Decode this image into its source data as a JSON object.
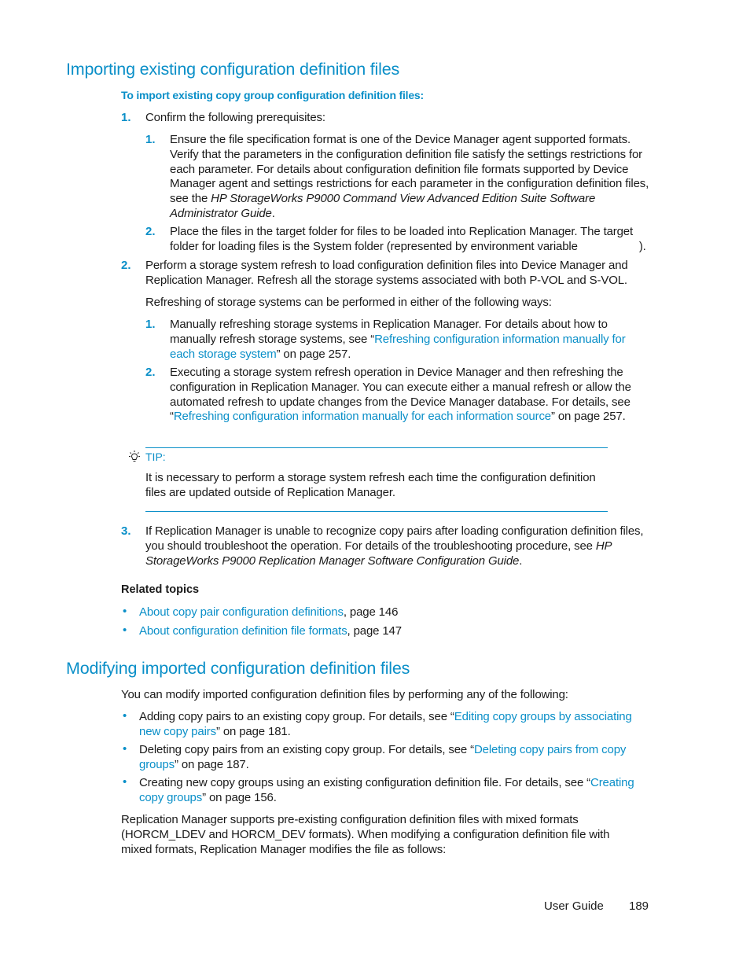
{
  "section1": {
    "heading": "Importing existing configuration definition files",
    "procedure_title": "To import existing copy group configuration definition files:",
    "steps": [
      {
        "number": "1.",
        "text": "Confirm the following prerequisites:",
        "substeps": [
          {
            "number": "1.",
            "text_a": "Ensure the file specification format is one of the Device Manager agent supported  formats. Verify that the parameters in the configuration definition file satisfy the settings restrictions for each parameter. For details about configuration definition file formats supported by Device Manager agent and settings restrictions for each parameter in the configuration definition files, see the ",
            "italic": "HP StorageWorks P9000 Command View Advanced Edition Suite Software Administrator Guide",
            "text_b": "."
          },
          {
            "number": "2.",
            "text_a": "Place the files in the target folder for files to be loaded into Replication Manager. The target folder for loading files is the System folder (represented by environment variable",
            "text_b": ")."
          }
        ]
      },
      {
        "number": "2.",
        "text": "Perform a storage system refresh to load configuration definition files into Device Manager and Replication Manager. Refresh all the storage systems associated with both P-VOL and S-VOL.",
        "para": "Refreshing of storage systems can be performed in either of the following ways:",
        "substeps": [
          {
            "number": "1.",
            "text_a": "Manually refreshing storage systems in Replication Manager. For details about how to manually refresh storage systems, see “",
            "link": "Refreshing configuration information manually for each storage system",
            "text_b": "” on page 257."
          },
          {
            "number": "2.",
            "text_a": "Executing a storage system refresh operation in Device Manager and then refreshing the configuration in Replication Manager. You can execute either a manual refresh or allow the automated refresh to update changes from the Device Manager database. For details, see “",
            "link": "Refreshing configuration information manually for each information source",
            "text_b": "” on page 257."
          }
        ]
      },
      {
        "number": "3.",
        "text_a": "If Replication Manager is unable to recognize copy pairs after loading configuration definition files, you should troubleshoot the operation. For details of the troubleshooting procedure, see ",
        "italic": "HP StorageWorks P9000 Replication Manager Software Configuration Guide",
        "text_b": "."
      }
    ],
    "tip": {
      "icon": "lightbulb-icon",
      "label": "TIP:",
      "text": "It is necessary to perform a storage system refresh each time the configuration definition files are updated outside of Replication Manager."
    },
    "related_topics": {
      "title": "Related topics",
      "items": [
        {
          "link": "About copy pair configuration definitions",
          "suffix": ", page 146"
        },
        {
          "link": "About configuration definition file formats",
          "suffix": ", page 147"
        }
      ]
    }
  },
  "section2": {
    "heading": "Modifying imported configuration definition files",
    "intro": "You can modify imported configuration definition files by performing any of the following:",
    "bullets": [
      {
        "text_a": "Adding copy pairs to an existing copy group. For details, see “",
        "link": "Editing copy groups by associating new copy pairs",
        "text_b": "” on page 181."
      },
      {
        "text_a": "Deleting copy pairs from an existing copy group. For details, see “",
        "link": "Deleting copy pairs from copy groups",
        "text_b": "” on page 187."
      },
      {
        "text_a": "Creating new copy groups using an existing configuration definition file. For details, see “",
        "link": "Creating copy groups",
        "text_b": "” on page 156."
      }
    ],
    "closing": "Replication Manager supports pre-existing configuration definition files with mixed formats (HORCM_LDEV and HORCM_DEV formats). When modifying a configuration definition file with mixed formats, Replication Manager modifies the file as follows:"
  },
  "footer": {
    "guide": "User Guide",
    "page": "189"
  },
  "colors": {
    "accent": "#0a8fc8",
    "text": "#1a1a1a"
  }
}
